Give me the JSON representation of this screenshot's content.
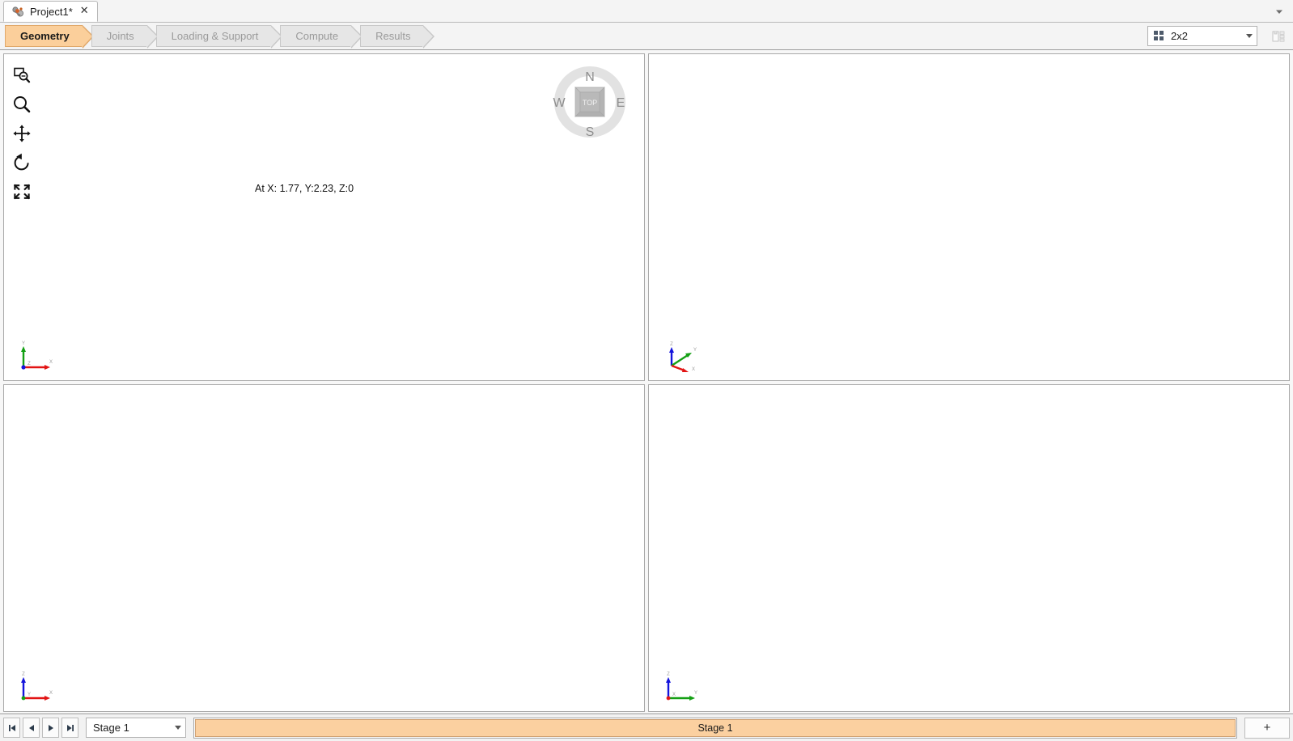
{
  "window": {
    "tab": {
      "title": "Project1*",
      "icon": "mechanism-icon",
      "close_label": "✕"
    },
    "overflow_icon": "chevron-down-icon"
  },
  "ribbon": {
    "steps": [
      {
        "label": "Geometry",
        "active": true
      },
      {
        "label": "Joints",
        "active": false
      },
      {
        "label": "Loading & Support",
        "active": false
      },
      {
        "label": "Compute",
        "active": false
      },
      {
        "label": "Results",
        "active": false
      }
    ],
    "layout_select": {
      "value": "2x2",
      "icon": "grid-2x2-icon",
      "caret": "chevron-down-icon"
    },
    "panel_button_icon": "panel-layout-icon"
  },
  "nav_tools": [
    {
      "name": "zoom-window-icon",
      "label": "Zoom Window"
    },
    {
      "name": "zoom-icon",
      "label": "Zoom"
    },
    {
      "name": "pan-icon",
      "label": "Pan"
    },
    {
      "name": "rotate-icon",
      "label": "Rotate"
    },
    {
      "name": "zoom-extents-icon",
      "label": "Zoom Extents"
    }
  ],
  "compass": {
    "north": "N",
    "south": "S",
    "east": "E",
    "west": "W",
    "face": "TOP"
  },
  "viewports": [
    {
      "id": "top-left",
      "view": "top",
      "coord_readout": "At X: 1.77, Y:2.23, Z:0",
      "axes": [
        {
          "label": "Y",
          "color": "#14a014"
        },
        {
          "label": "X",
          "color": "#e21414"
        },
        {
          "label": "Z",
          "color": "#1414dc"
        }
      ]
    },
    {
      "id": "top-right",
      "view": "isometric",
      "axes": [
        {
          "label": "Z",
          "color": "#1414dc"
        },
        {
          "label": "Y",
          "color": "#14a014"
        },
        {
          "label": "X",
          "color": "#e21414"
        }
      ]
    },
    {
      "id": "bottom-left",
      "view": "front",
      "axes": [
        {
          "label": "Z",
          "color": "#1414dc"
        },
        {
          "label": "X",
          "color": "#e21414"
        },
        {
          "label": "Y",
          "color": "#14a014"
        }
      ]
    },
    {
      "id": "bottom-right",
      "view": "side",
      "axes": [
        {
          "label": "Z",
          "color": "#1414dc"
        },
        {
          "label": "Y",
          "color": "#14a014"
        },
        {
          "label": "X",
          "color": "#e21414"
        }
      ]
    }
  ],
  "stagebar": {
    "nav_first": "⏮",
    "nav_prev": "◀",
    "nav_next": "▶",
    "nav_last": "⏭",
    "stage_select_value": "Stage 1",
    "stage_block_label": "Stage 1",
    "add_label": "+"
  },
  "colors": {
    "accent": "#fbcf9b",
    "accent_border": "#e0a86a",
    "stage_fill": "#fbd0a0",
    "axis_x": "#e21414",
    "axis_y": "#14a014",
    "axis_z": "#1414dc"
  }
}
